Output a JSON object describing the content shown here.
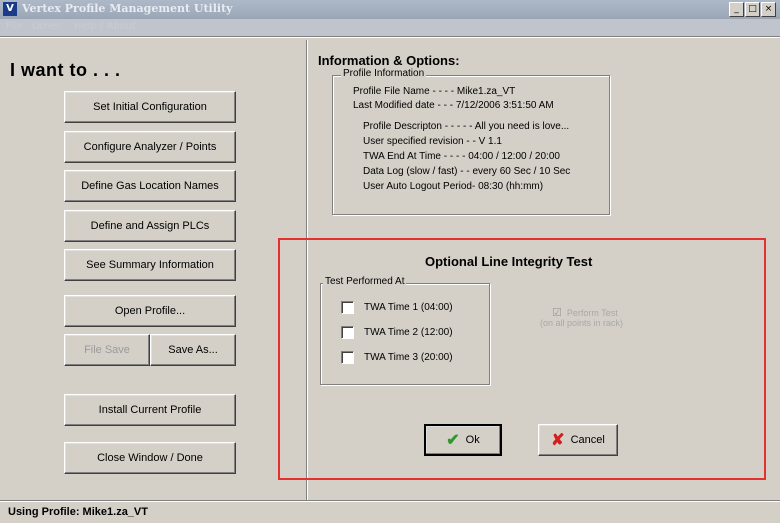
{
  "window": {
    "title": "Vertex Profile Management Utility",
    "app_icon": "app-logo-icon",
    "controls": [
      "minimize-icon",
      "maximize-icon",
      "close-icon"
    ]
  },
  "menu": [
    {
      "label": "File"
    },
    {
      "label": "Other"
    },
    {
      "label": "Help / About"
    }
  ],
  "left": {
    "heading": "I want to . . .",
    "buttons": {
      "set_initial": "Set Initial Configuration",
      "configure": "Configure Analyzer / Points",
      "define_gas": "Define Gas Location Names",
      "define_plcs": "Define and Assign PLCs",
      "summary": "See Summary Information",
      "open_profile": "Open Profile...",
      "file_save": "File Save",
      "save_as": "Save As...",
      "install": "Install Current Profile",
      "close": "Close Window / Done"
    }
  },
  "info": {
    "title": "Information & Options:",
    "group_label": "Profile Information",
    "file_name": "Profile File Name - - - -  Mike1.za_VT",
    "last_modified": "Last Modified date - - -  7/12/2006 3:51:50 AM",
    "description": "Profile Descripton - - - - - All you need is love...",
    "revision": "User specified revision - - V 1.1",
    "twa_end": "TWA End At Time - - - -  04:00  /  12:00  /  20:00",
    "data_log": "Data  Log (slow / fast) - - every 60 Sec / 10 Sec",
    "logout": "User Auto Logout Period-  08:30 (hh:mm)"
  },
  "integrity": {
    "title": "Optional Line Integrity Test",
    "group_label": "Test Performed At",
    "checks": [
      {
        "label": "TWA Time 1  (04:00)"
      },
      {
        "label": "TWA Time 2  (12:00)"
      },
      {
        "label": "TWA Time 3  (20:00)"
      }
    ],
    "perform_label": "Perform Test",
    "perform_sub": "(on all points in rack)",
    "ok_label": "Ok",
    "cancel_label": "Cancel",
    "ok_icon": "checkmark-icon",
    "cancel_icon": "x-icon"
  },
  "status": {
    "label": "Using Profile:  Mike1.za_VT"
  },
  "colors": {
    "highlight_border": "#e53030",
    "ok_check": "#2a9a2a",
    "cancel_x": "#d22020"
  }
}
